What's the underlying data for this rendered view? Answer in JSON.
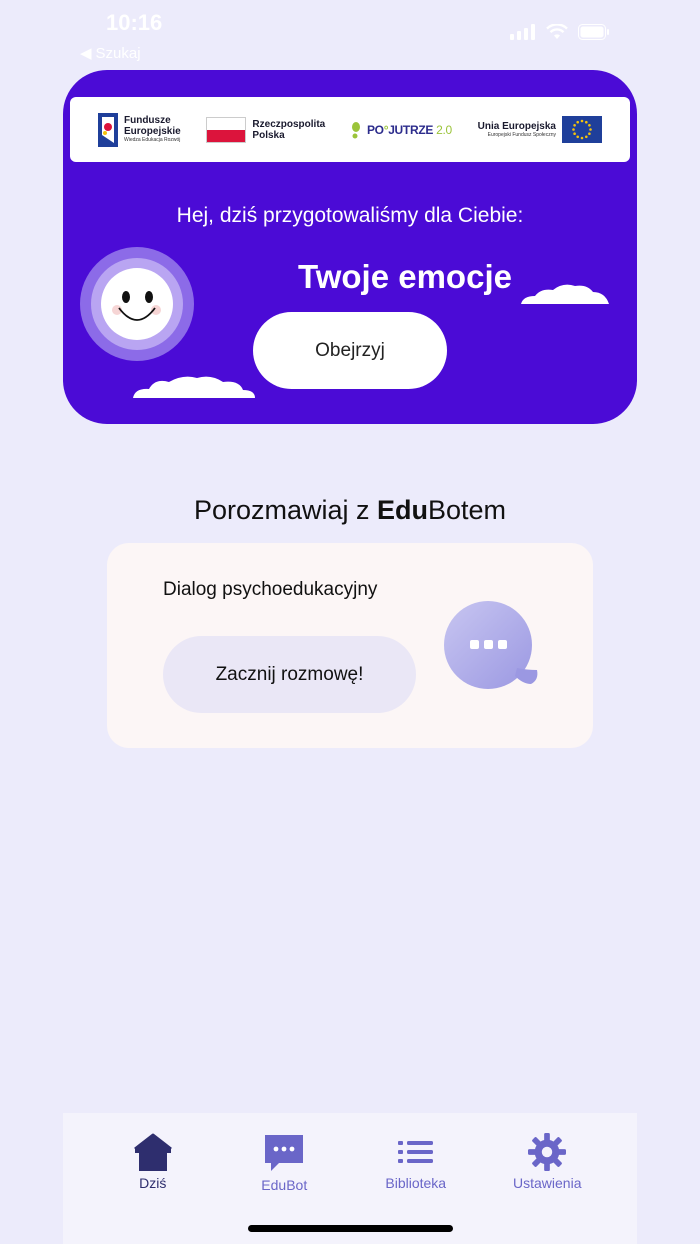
{
  "status_bar": {
    "time": "10:16",
    "back_label": "Szukaj"
  },
  "hero": {
    "background_color": "#4B0BD6",
    "logos": {
      "fe_line1": "Fundusze",
      "fe_line2": "Europejskie",
      "fe_sub": "Wiedza Edukacja Rozwój",
      "rp_line1": "Rzeczpospolita",
      "rp_line2": "Polska",
      "pojutrze_a": "PO",
      "pojutrze_b": "JUTRZE",
      "pojutrze_c": "2.0",
      "ue_line1": "Unia Europejska",
      "ue_sub": "Europejski Fundusz Społeczny"
    },
    "greeting": "Hej, dziś przygotowaliśmy dla Ciebie:",
    "title": "Twoje emocje",
    "watch_label": "Obejrzyj"
  },
  "edubot": {
    "heading_prefix": "Porozmawiaj z ",
    "heading_bold": "Edu",
    "heading_suffix": "Botem",
    "card_title": "Dialog psychoedukacyjny",
    "start_label": "Zacznij rozmowę!"
  },
  "tabbar": {
    "items": [
      {
        "label": "Dziś",
        "icon": "home-icon",
        "active": true
      },
      {
        "label": "EduBot",
        "icon": "chat-icon",
        "active": false
      },
      {
        "label": "Biblioteka",
        "icon": "list-icon",
        "active": false
      },
      {
        "label": "Ustawienia",
        "icon": "gear-icon",
        "active": false
      }
    ]
  },
  "colors": {
    "accent": "#4B0BD6",
    "tab_active": "#2E2E6E",
    "tab_inactive": "#6A66C8",
    "page_bg": "#ECEBFB"
  }
}
